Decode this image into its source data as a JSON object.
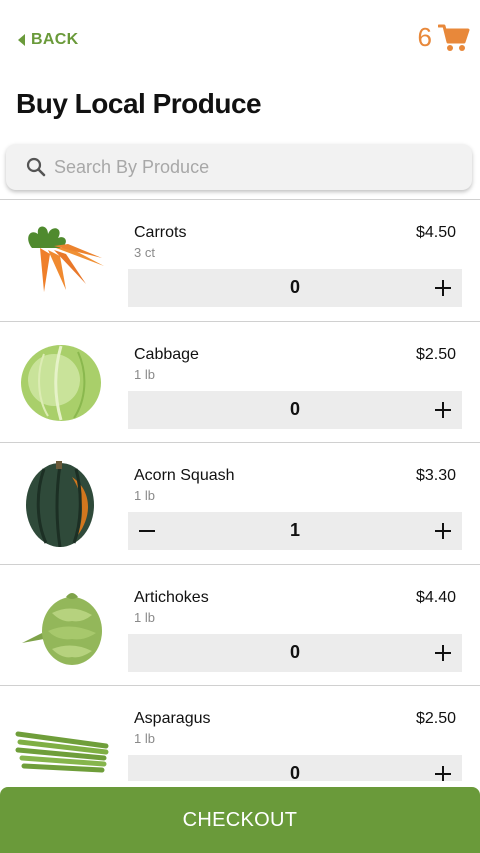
{
  "header": {
    "back_label": "BACK",
    "cart_count": "6"
  },
  "page_title": "Buy Local Produce",
  "search": {
    "placeholder": "Search By Produce",
    "value": ""
  },
  "items": [
    {
      "name": "Carrots",
      "unit": "3 ct",
      "price": "$4.50",
      "qty": "0",
      "image": "carrots"
    },
    {
      "name": "Cabbage",
      "unit": "1 lb",
      "price": "$2.50",
      "qty": "0",
      "image": "cabbage"
    },
    {
      "name": "Acorn Squash",
      "unit": "1 lb",
      "price": "$3.30",
      "qty": "1",
      "image": "acorn-squash"
    },
    {
      "name": "Artichokes",
      "unit": "1 lb",
      "price": "$4.40",
      "qty": "0",
      "image": "artichokes"
    },
    {
      "name": "Asparagus",
      "unit": "1 lb",
      "price": "$2.50",
      "qty": "0",
      "image": "asparagus"
    }
  ],
  "checkout_label": "CHECKOUT",
  "colors": {
    "accent_green": "#6a9a3a",
    "cart_orange": "#e8883a"
  }
}
